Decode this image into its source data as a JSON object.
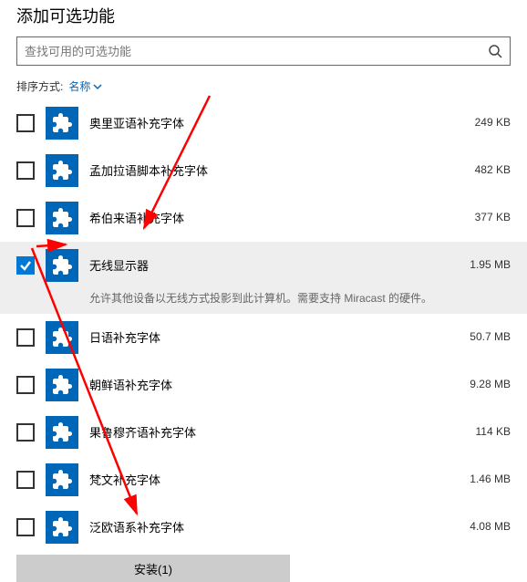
{
  "title": "添加可选功能",
  "search": {
    "placeholder": "查找可用的可选功能"
  },
  "sort": {
    "label": "排序方式:",
    "value": "名称"
  },
  "items": [
    {
      "name": "奥里亚语补充字体",
      "size": "249 KB",
      "checked": false,
      "desc": ""
    },
    {
      "name": "孟加拉语脚本补充字体",
      "size": "482 KB",
      "checked": false,
      "desc": ""
    },
    {
      "name": "希伯来语补充字体",
      "size": "377 KB",
      "checked": false,
      "desc": ""
    },
    {
      "name": "无线显示器",
      "size": "1.95 MB",
      "checked": true,
      "desc": "允许其他设备以无线方式投影到此计算机。需要支持 Miracast 的硬件。"
    },
    {
      "name": "日语补充字体",
      "size": "50.7 MB",
      "checked": false,
      "desc": ""
    },
    {
      "name": "朝鲜语补充字体",
      "size": "9.28 MB",
      "checked": false,
      "desc": ""
    },
    {
      "name": "果鲁穆齐语补充字体",
      "size": "114 KB",
      "checked": false,
      "desc": ""
    },
    {
      "name": "梵文补充字体",
      "size": "1.46 MB",
      "checked": false,
      "desc": ""
    },
    {
      "name": "泛欧语系补充字体",
      "size": "4.08 MB",
      "checked": false,
      "desc": ""
    }
  ],
  "install_button": "安装(1)"
}
